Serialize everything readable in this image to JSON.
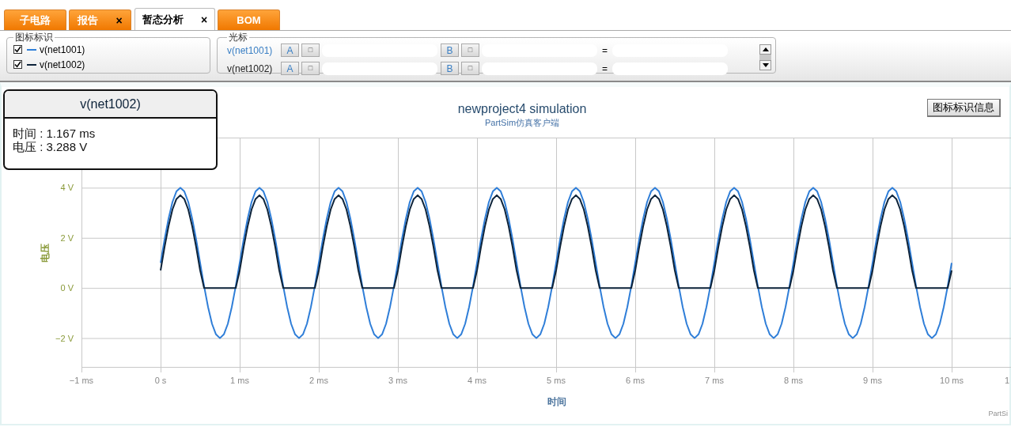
{
  "tabs": [
    {
      "label": "子电路",
      "selected": false,
      "closable": false
    },
    {
      "label": "报告",
      "selected": false,
      "closable": true
    },
    {
      "label": "暂态分析",
      "selected": true,
      "closable": true
    },
    {
      "label": "BOM",
      "selected": false,
      "closable": false
    }
  ],
  "close_glyph": "×",
  "legend": {
    "title": "图标标识",
    "items": [
      {
        "checked": true
      },
      {
        "checked": true
      }
    ]
  },
  "cursor": {
    "title": "光标",
    "rows": [
      {
        "label": "v(net1001)",
        "a": "A",
        "a_small": "□",
        "b": "B",
        "b_small": "□",
        "equals": "="
      },
      {
        "label": "v(net1002)",
        "a": "A",
        "a_small": "□",
        "b": "B",
        "b_small": "□",
        "equals": "="
      }
    ]
  },
  "tooltip": {
    "title": "v(net1002)",
    "lines": [
      "时间 : 1.167 ms",
      "电压 : 3.288 V"
    ]
  },
  "legend_info_button": "图标标识信息",
  "credit": "PartSi",
  "chart_edge_label": "1",
  "chart_data": {
    "type": "line",
    "title": "newproject4 simulation",
    "subtitle": "PartSim仿真客户端",
    "xlabel": "时间",
    "ylabel": "电压",
    "grid": true,
    "xlim": [
      -1,
      10.75
    ],
    "ylim": [
      -3.15,
      6
    ],
    "xticks": [
      {
        "value": -1,
        "label": "−1 ms"
      },
      {
        "value": 0,
        "label": "0 s"
      },
      {
        "value": 1,
        "label": "1 ms"
      },
      {
        "value": 2,
        "label": "2 ms"
      },
      {
        "value": 3,
        "label": "3 ms"
      },
      {
        "value": 4,
        "label": "4 ms"
      },
      {
        "value": 5,
        "label": "5 ms"
      },
      {
        "value": 6,
        "label": "6 ms"
      },
      {
        "value": 7,
        "label": "7 ms"
      },
      {
        "value": 8,
        "label": "8 ms"
      },
      {
        "value": 9,
        "label": "9 ms"
      },
      {
        "value": 10,
        "label": "10 ms"
      }
    ],
    "yticks": [
      {
        "value": -2,
        "label": "−2 V"
      },
      {
        "value": 0,
        "label": "0 V"
      },
      {
        "value": 2,
        "label": "2 V"
      },
      {
        "value": 4,
        "label": "4 V"
      }
    ],
    "x": [
      0,
      0.05,
      0.1,
      0.15,
      0.2,
      0.25,
      0.3,
      0.35,
      0.4,
      0.45,
      0.5,
      0.55,
      0.6,
      0.65,
      0.7,
      0.75,
      0.8,
      0.85,
      0.9,
      0.95,
      1,
      1.05,
      1.1,
      1.15,
      1.2,
      1.25,
      1.3,
      1.35,
      1.4,
      1.45,
      1.5,
      1.55,
      1.6,
      1.65,
      1.7,
      1.75,
      1.8,
      1.85,
      1.9,
      1.95,
      2,
      2.05,
      2.1,
      2.15,
      2.2,
      2.25,
      2.3,
      2.35,
      2.4,
      2.45,
      2.5,
      2.55,
      2.6,
      2.65,
      2.7,
      2.75,
      2.8,
      2.85,
      2.9,
      2.95,
      3,
      3.05,
      3.1,
      3.15,
      3.2,
      3.25,
      3.3,
      3.35,
      3.4,
      3.45,
      3.5,
      3.55,
      3.6,
      3.65,
      3.7,
      3.75,
      3.8,
      3.85,
      3.9,
      3.95,
      4,
      4.05,
      4.1,
      4.15,
      4.2,
      4.25,
      4.3,
      4.35,
      4.4,
      4.45,
      4.5,
      4.55,
      4.6,
      4.65,
      4.7,
      4.75,
      4.8,
      4.85,
      4.9,
      4.95,
      5,
      5.05,
      5.1,
      5.15,
      5.2,
      5.25,
      5.3,
      5.35,
      5.4,
      5.45,
      5.5,
      5.55,
      5.6,
      5.65,
      5.7,
      5.75,
      5.8,
      5.85,
      5.9,
      5.95,
      6,
      6.05,
      6.1,
      6.15,
      6.2,
      6.25,
      6.3,
      6.35,
      6.4,
      6.45,
      6.5,
      6.55,
      6.6,
      6.65,
      6.7,
      6.75,
      6.8,
      6.85,
      6.9,
      6.95,
      7,
      7.05,
      7.1,
      7.15,
      7.2,
      7.25,
      7.3,
      7.35,
      7.4,
      7.45,
      7.5,
      7.55,
      7.6,
      7.65,
      7.7,
      7.75,
      7.8,
      7.85,
      7.9,
      7.95,
      8,
      8.05,
      8.1,
      8.15,
      8.2,
      8.25,
      8.3,
      8.35,
      8.4,
      8.45,
      8.5,
      8.55,
      8.6,
      8.65,
      8.7,
      8.75,
      8.8,
      8.85,
      8.9,
      8.95,
      9,
      9.05,
      9.1,
      9.15,
      9.2,
      9.25,
      9.3,
      9.35,
      9.4,
      9.45,
      9.5,
      9.55,
      9.6,
      9.65,
      9.7,
      9.75,
      9.8,
      9.85,
      9.9,
      9.95,
      10
    ],
    "series": [
      {
        "name": "v(net1001)",
        "color": "#2f7ed8",
        "values": [
          1,
          1.93,
          2.76,
          3.43,
          3.85,
          4,
          3.85,
          3.43,
          2.76,
          1.93,
          1,
          0.07,
          -0.76,
          -1.43,
          -1.85,
          -2,
          -1.85,
          -1.43,
          -0.76,
          0.07,
          1,
          1.93,
          2.76,
          3.43,
          3.85,
          4,
          3.85,
          3.43,
          2.76,
          1.93,
          1,
          0.07,
          -0.76,
          -1.43,
          -1.85,
          -2,
          -1.85,
          -1.43,
          -0.76,
          0.07,
          1,
          1.93,
          2.76,
          3.43,
          3.85,
          4,
          3.85,
          3.43,
          2.76,
          1.93,
          1,
          0.07,
          -0.76,
          -1.43,
          -1.85,
          -2,
          -1.85,
          -1.43,
          -0.76,
          0.07,
          1,
          1.93,
          2.76,
          3.43,
          3.85,
          4,
          3.85,
          3.43,
          2.76,
          1.93,
          1,
          0.07,
          -0.76,
          -1.43,
          -1.85,
          -2,
          -1.85,
          -1.43,
          -0.76,
          0.07,
          1,
          1.93,
          2.76,
          3.43,
          3.85,
          4,
          3.85,
          3.43,
          2.76,
          1.93,
          1,
          0.07,
          -0.76,
          -1.43,
          -1.85,
          -2,
          -1.85,
          -1.43,
          -0.76,
          0.07,
          1,
          1.93,
          2.76,
          3.43,
          3.85,
          4,
          3.85,
          3.43,
          2.76,
          1.93,
          1,
          0.07,
          -0.76,
          -1.43,
          -1.85,
          -2,
          -1.85,
          -1.43,
          -0.76,
          0.07,
          1,
          1.93,
          2.76,
          3.43,
          3.85,
          4,
          3.85,
          3.43,
          2.76,
          1.93,
          1,
          0.07,
          -0.76,
          -1.43,
          -1.85,
          -2,
          -1.85,
          -1.43,
          -0.76,
          0.07,
          1,
          1.93,
          2.76,
          3.43,
          3.85,
          4,
          3.85,
          3.43,
          2.76,
          1.93,
          1,
          0.07,
          -0.76,
          -1.43,
          -1.85,
          -2,
          -1.85,
          -1.43,
          -0.76,
          0.07,
          1,
          1.93,
          2.76,
          3.43,
          3.85,
          4,
          3.85,
          3.43,
          2.76,
          1.93,
          1,
          0.07,
          -0.76,
          -1.43,
          -1.85,
          -2,
          -1.85,
          -1.43,
          -0.76,
          0.07,
          1,
          1.93,
          2.76,
          3.43,
          3.85,
          4,
          3.85,
          3.43,
          2.76,
          1.93,
          1,
          0.07,
          -0.76,
          -1.43,
          -1.85,
          -2,
          -1.85,
          -1.43,
          -0.76,
          0.07,
          1
        ]
      },
      {
        "name": "v(net1002)",
        "color": "#0d233a",
        "values": [
          0.7,
          1.63,
          2.46,
          3.13,
          3.55,
          3.7,
          3.55,
          3.13,
          2.46,
          1.63,
          0.7,
          0,
          0,
          0,
          0,
          0,
          0,
          0,
          0,
          0,
          0.7,
          1.63,
          2.46,
          3.13,
          3.55,
          3.7,
          3.55,
          3.13,
          2.46,
          1.63,
          0.7,
          0,
          0,
          0,
          0,
          0,
          0,
          0,
          0,
          0,
          0.7,
          1.63,
          2.46,
          3.13,
          3.55,
          3.7,
          3.55,
          3.13,
          2.46,
          1.63,
          0.7,
          0,
          0,
          0,
          0,
          0,
          0,
          0,
          0,
          0,
          0.7,
          1.63,
          2.46,
          3.13,
          3.55,
          3.7,
          3.55,
          3.13,
          2.46,
          1.63,
          0.7,
          0,
          0,
          0,
          0,
          0,
          0,
          0,
          0,
          0,
          0.7,
          1.63,
          2.46,
          3.13,
          3.55,
          3.7,
          3.55,
          3.13,
          2.46,
          1.63,
          0.7,
          0,
          0,
          0,
          0,
          0,
          0,
          0,
          0,
          0,
          0.7,
          1.63,
          2.46,
          3.13,
          3.55,
          3.7,
          3.55,
          3.13,
          2.46,
          1.63,
          0.7,
          0,
          0,
          0,
          0,
          0,
          0,
          0,
          0,
          0,
          0.7,
          1.63,
          2.46,
          3.13,
          3.55,
          3.7,
          3.55,
          3.13,
          2.46,
          1.63,
          0.7,
          0,
          0,
          0,
          0,
          0,
          0,
          0,
          0,
          0,
          0.7,
          1.63,
          2.46,
          3.13,
          3.55,
          3.7,
          3.55,
          3.13,
          2.46,
          1.63,
          0.7,
          0,
          0,
          0,
          0,
          0,
          0,
          0,
          0,
          0,
          0.7,
          1.63,
          2.46,
          3.13,
          3.55,
          3.7,
          3.55,
          3.13,
          2.46,
          1.63,
          0.7,
          0,
          0,
          0,
          0,
          0,
          0,
          0,
          0,
          0,
          0.7,
          1.63,
          2.46,
          3.13,
          3.55,
          3.7,
          3.55,
          3.13,
          2.46,
          1.63,
          0.7,
          0,
          0,
          0,
          0,
          0,
          0,
          0,
          0,
          0,
          0.7
        ]
      }
    ]
  }
}
